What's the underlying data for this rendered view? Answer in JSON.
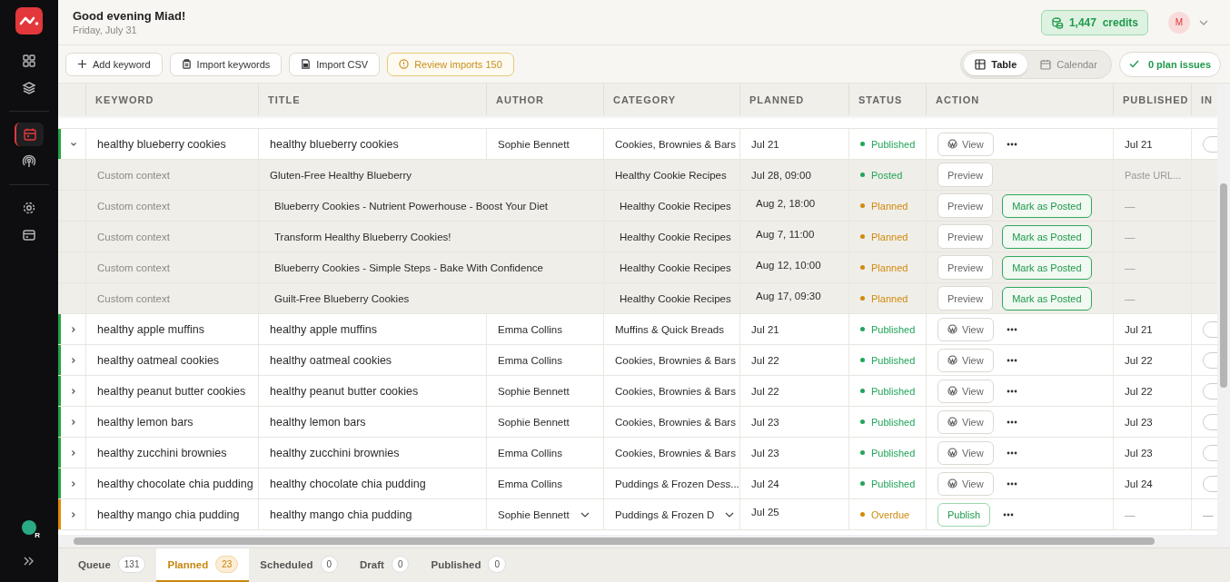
{
  "header": {
    "greeting": "Good evening Miad!",
    "date": "Friday, July 31",
    "credits": "1,447  credits",
    "avatar": "M"
  },
  "sidebar": {
    "items": [
      {
        "kind": "dashboard",
        "selected": false
      },
      {
        "kind": "layers",
        "selected": false
      },
      {
        "kind": "calendar",
        "selected": true
      },
      {
        "kind": "broadcast",
        "selected": false
      },
      {
        "kind": "settings",
        "selected": false
      },
      {
        "kind": "card",
        "selected": false
      }
    ],
    "user_initial": "R"
  },
  "toolbar": {
    "buttons": [
      {
        "kind": "add",
        "label": "Add keyword"
      },
      {
        "kind": "import",
        "label": "Import keywords"
      },
      {
        "kind": "csv",
        "label": "Import CSV"
      },
      {
        "kind": "review",
        "label": "Review imports 150"
      }
    ],
    "views": [
      {
        "kind": "table",
        "label": "Table",
        "selected": true
      },
      {
        "kind": "calendar",
        "label": "Calendar",
        "selected": false
      }
    ],
    "plan_issues": "0 plan issues"
  },
  "table": {
    "columns": [
      "KEYWORD",
      "TITLE",
      "AUTHOR",
      "CATEGORY",
      "PLANNED",
      "STATUS",
      "ACTION",
      "PUBLISHED",
      "IN"
    ],
    "rows": [
      {
        "kind": "item",
        "color": "#22a447",
        "expanded": true,
        "keyword": "healthy blueberry cookies",
        "title": "healthy blueberry cookies",
        "author": "Sophie Bennett",
        "category": "Cookies, Brownies & Bars",
        "planned": "Jul 21",
        "status": {
          "label": "Published",
          "color": "#22a55a"
        },
        "action": {
          "kind": "view",
          "label": "View"
        },
        "published": "Jul 21",
        "toggle_on": false
      },
      {
        "kind": "variant",
        "context": "Custom context",
        "title": "Gluten-Free Healthy Blueberry",
        "category": "Healthy Cookie Recipes",
        "planned": "Jul 28, 09:00",
        "status": {
          "label": "Posted",
          "color": "#22a55a"
        },
        "preview": "Preview",
        "published_placeholder": "Paste URL..."
      },
      {
        "kind": "variant",
        "context": "Custom context",
        "title": "Blueberry Cookies - Nutrient Powerhouse - Boost Your Diet",
        "category": "Healthy Cookie Recipes",
        "planned": "Aug 2, 18:00",
        "status": {
          "label": "Planned",
          "color": "#d18a0c"
        },
        "preview": "Preview",
        "mark": "Mark as Posted",
        "published": "—"
      },
      {
        "kind": "variant",
        "context": "Custom context",
        "title": "Transform Healthy Blueberry Cookies!",
        "category": "Healthy Cookie Recipes",
        "planned": "Aug 7, 11:00",
        "status": {
          "label": "Planned",
          "color": "#d18a0c"
        },
        "preview": "Preview",
        "mark": "Mark as Posted",
        "published": "—"
      },
      {
        "kind": "variant",
        "context": "Custom context",
        "title": "Blueberry Cookies - Simple Steps - Bake With Confidence",
        "category": "Healthy Cookie Recipes",
        "planned": "Aug 12, 10:00",
        "status": {
          "label": "Planned",
          "color": "#d18a0c"
        },
        "preview": "Preview",
        "mark": "Mark as Posted",
        "published": "—"
      },
      {
        "kind": "variant",
        "context": "Custom context",
        "title": "Guilt-Free Blueberry Cookies",
        "category": "Healthy Cookie Recipes",
        "planned": "Aug 17, 09:30",
        "status": {
          "label": "Planned",
          "color": "#d18a0c"
        },
        "preview": "Preview",
        "mark": "Mark as Posted",
        "published": "—"
      },
      {
        "kind": "item",
        "color": "#22a447",
        "expanded": false,
        "keyword": "healthy apple muffins",
        "title": "healthy apple muffins",
        "author": "Emma Collins",
        "category": "Muffins & Quick Breads",
        "planned": "Jul 21",
        "status": {
          "label": "Published",
          "color": "#22a55a"
        },
        "action": {
          "kind": "view",
          "label": "View"
        },
        "published": "Jul 21",
        "toggle_on": false
      },
      {
        "kind": "item",
        "color": "#22a447",
        "expanded": false,
        "keyword": "healthy oatmeal cookies",
        "title": "healthy oatmeal cookies",
        "author": "Emma Collins",
        "category": "Cookies, Brownies & Bars",
        "planned": "Jul 22",
        "status": {
          "label": "Published",
          "color": "#22a55a"
        },
        "action": {
          "kind": "view",
          "label": "View"
        },
        "published": "Jul 22",
        "toggle_on": false
      },
      {
        "kind": "item",
        "color": "#22a447",
        "expanded": false,
        "keyword": "healthy peanut butter cookies",
        "title": "healthy peanut butter cookies",
        "author": "Sophie Bennett",
        "category": "Cookies, Brownies & Bars",
        "planned": "Jul 22",
        "status": {
          "label": "Published",
          "color": "#22a55a"
        },
        "action": {
          "kind": "view",
          "label": "View"
        },
        "published": "Jul 22",
        "toggle_on": false
      },
      {
        "kind": "item",
        "color": "#22a447",
        "expanded": false,
        "keyword": "healthy lemon bars",
        "title": "healthy lemon bars",
        "author": "Sophie Bennett",
        "category": "Cookies, Brownies & Bars",
        "planned": "Jul 23",
        "status": {
          "label": "Published",
          "color": "#22a55a"
        },
        "action": {
          "kind": "view",
          "label": "View"
        },
        "published": "Jul 23",
        "toggle_on": false
      },
      {
        "kind": "item",
        "color": "#22a447",
        "expanded": false,
        "keyword": "healthy zucchini brownies",
        "title": "healthy zucchini brownies",
        "author": "Emma Collins",
        "category": "Cookies, Brownies & Bars",
        "planned": "Jul 23",
        "status": {
          "label": "Published",
          "color": "#22a55a"
        },
        "action": {
          "kind": "view",
          "label": "View"
        },
        "published": "Jul 23",
        "toggle_on": false
      },
      {
        "kind": "item",
        "color": "#22a447",
        "expanded": false,
        "keyword": "healthy chocolate chia pudding",
        "title": "healthy chocolate chia pudding",
        "author": "Emma Collins",
        "category": "Puddings & Frozen Dess...",
        "planned": "Jul 24",
        "status": {
          "label": "Published",
          "color": "#22a55a"
        },
        "action": {
          "kind": "view",
          "label": "View"
        },
        "published": "Jul 24",
        "toggle_on": false
      },
      {
        "kind": "item",
        "color": "#e08a00",
        "expanded": false,
        "editable": true,
        "keyword": "healthy mango chia pudding",
        "title": "healthy mango chia pudding",
        "author": "Sophie Bennett",
        "category": "Puddings & Frozen D",
        "planned": "Jul 25",
        "status": {
          "label": "Overdue",
          "color": "#d18a0c"
        },
        "action": {
          "kind": "publish",
          "label": "Publish"
        },
        "published": "—",
        "ind": "—"
      }
    ]
  },
  "bottom_tabs": [
    {
      "label": "Queue",
      "count": "131",
      "selected": false
    },
    {
      "label": "Planned",
      "count": "23",
      "selected": true
    },
    {
      "label": "Scheduled",
      "count": "0",
      "selected": false
    },
    {
      "label": "Draft",
      "count": "0",
      "selected": false
    },
    {
      "label": "Published",
      "count": "0",
      "selected": false
    }
  ]
}
